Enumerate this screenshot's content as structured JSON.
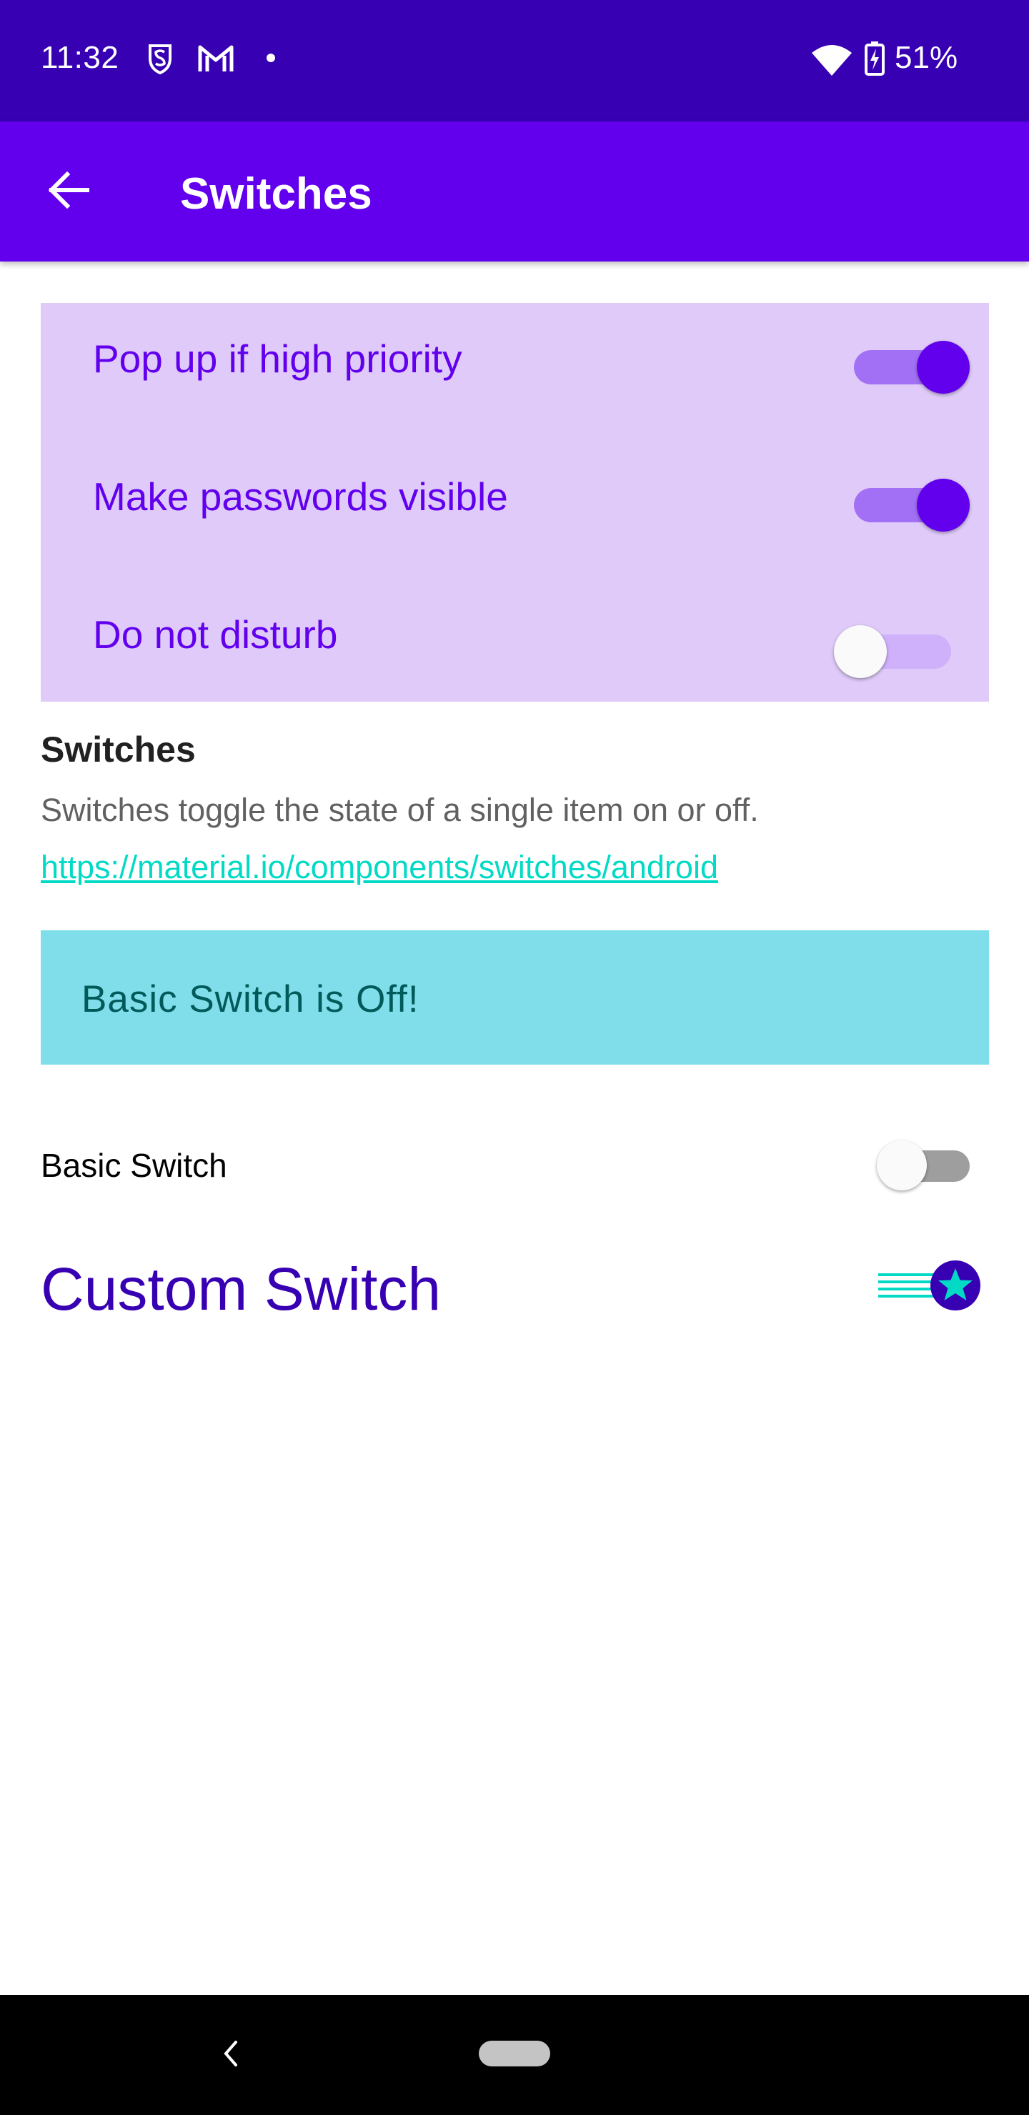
{
  "status_bar": {
    "time": "11:32",
    "battery": "51%",
    "icons": [
      "s-shield-icon",
      "gmail-icon",
      "dot-icon",
      "wifi-icon",
      "battery-charging-icon"
    ]
  },
  "app_bar": {
    "title": "Switches",
    "back_icon": "arrow-back-icon"
  },
  "settings": [
    {
      "label": "Pop up if high priority",
      "checked": true
    },
    {
      "label": "Make passwords visible",
      "checked": true
    },
    {
      "label": "Do not disturb",
      "checked": false
    }
  ],
  "description": {
    "title": "Switches",
    "text": "Switches toggle the state of a single item on or off.",
    "link": "https://material.io/components/switches/android"
  },
  "banner": {
    "text": "Basic Switch is Off!"
  },
  "basic_switch": {
    "label": "Basic Switch",
    "checked": false
  },
  "custom_switch": {
    "label": "Custom Switch",
    "checked": true,
    "icon": "star-icon"
  },
  "nav_bar": {
    "back_icon": "nav-back-icon",
    "home_icon": "home-pill-icon"
  },
  "colors": {
    "status_bar": "#3700b3",
    "app_bar": "#6200ee",
    "panel": "#dfcaf9",
    "banner": "#80deea",
    "link": "#03dac6",
    "custom_accent": "#3700b3"
  }
}
